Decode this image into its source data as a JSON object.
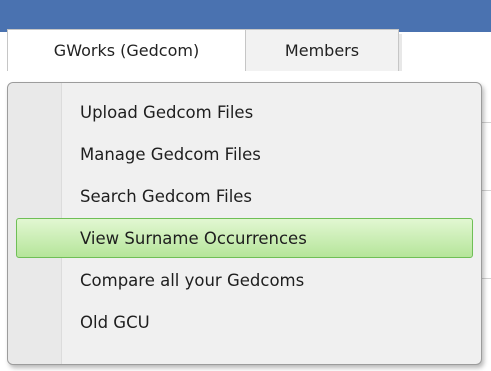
{
  "tabs": [
    {
      "label": "GWorks (Gedcom)",
      "active": true
    },
    {
      "label": "Members",
      "active": false
    }
  ],
  "menu": {
    "items": [
      {
        "label": "Upload Gedcom Files"
      },
      {
        "label": "Manage Gedcom Files"
      },
      {
        "label": "Search Gedcom Files"
      },
      {
        "label": "View Surname Occurrences",
        "highlighted": true
      },
      {
        "label": "Compare all your Gedcoms"
      },
      {
        "label": "Old GCU"
      }
    ]
  },
  "colors": {
    "header_bar": "#4a72b0",
    "highlight_border": "#6fbf56",
    "highlight_fill": "#b5e59a"
  }
}
